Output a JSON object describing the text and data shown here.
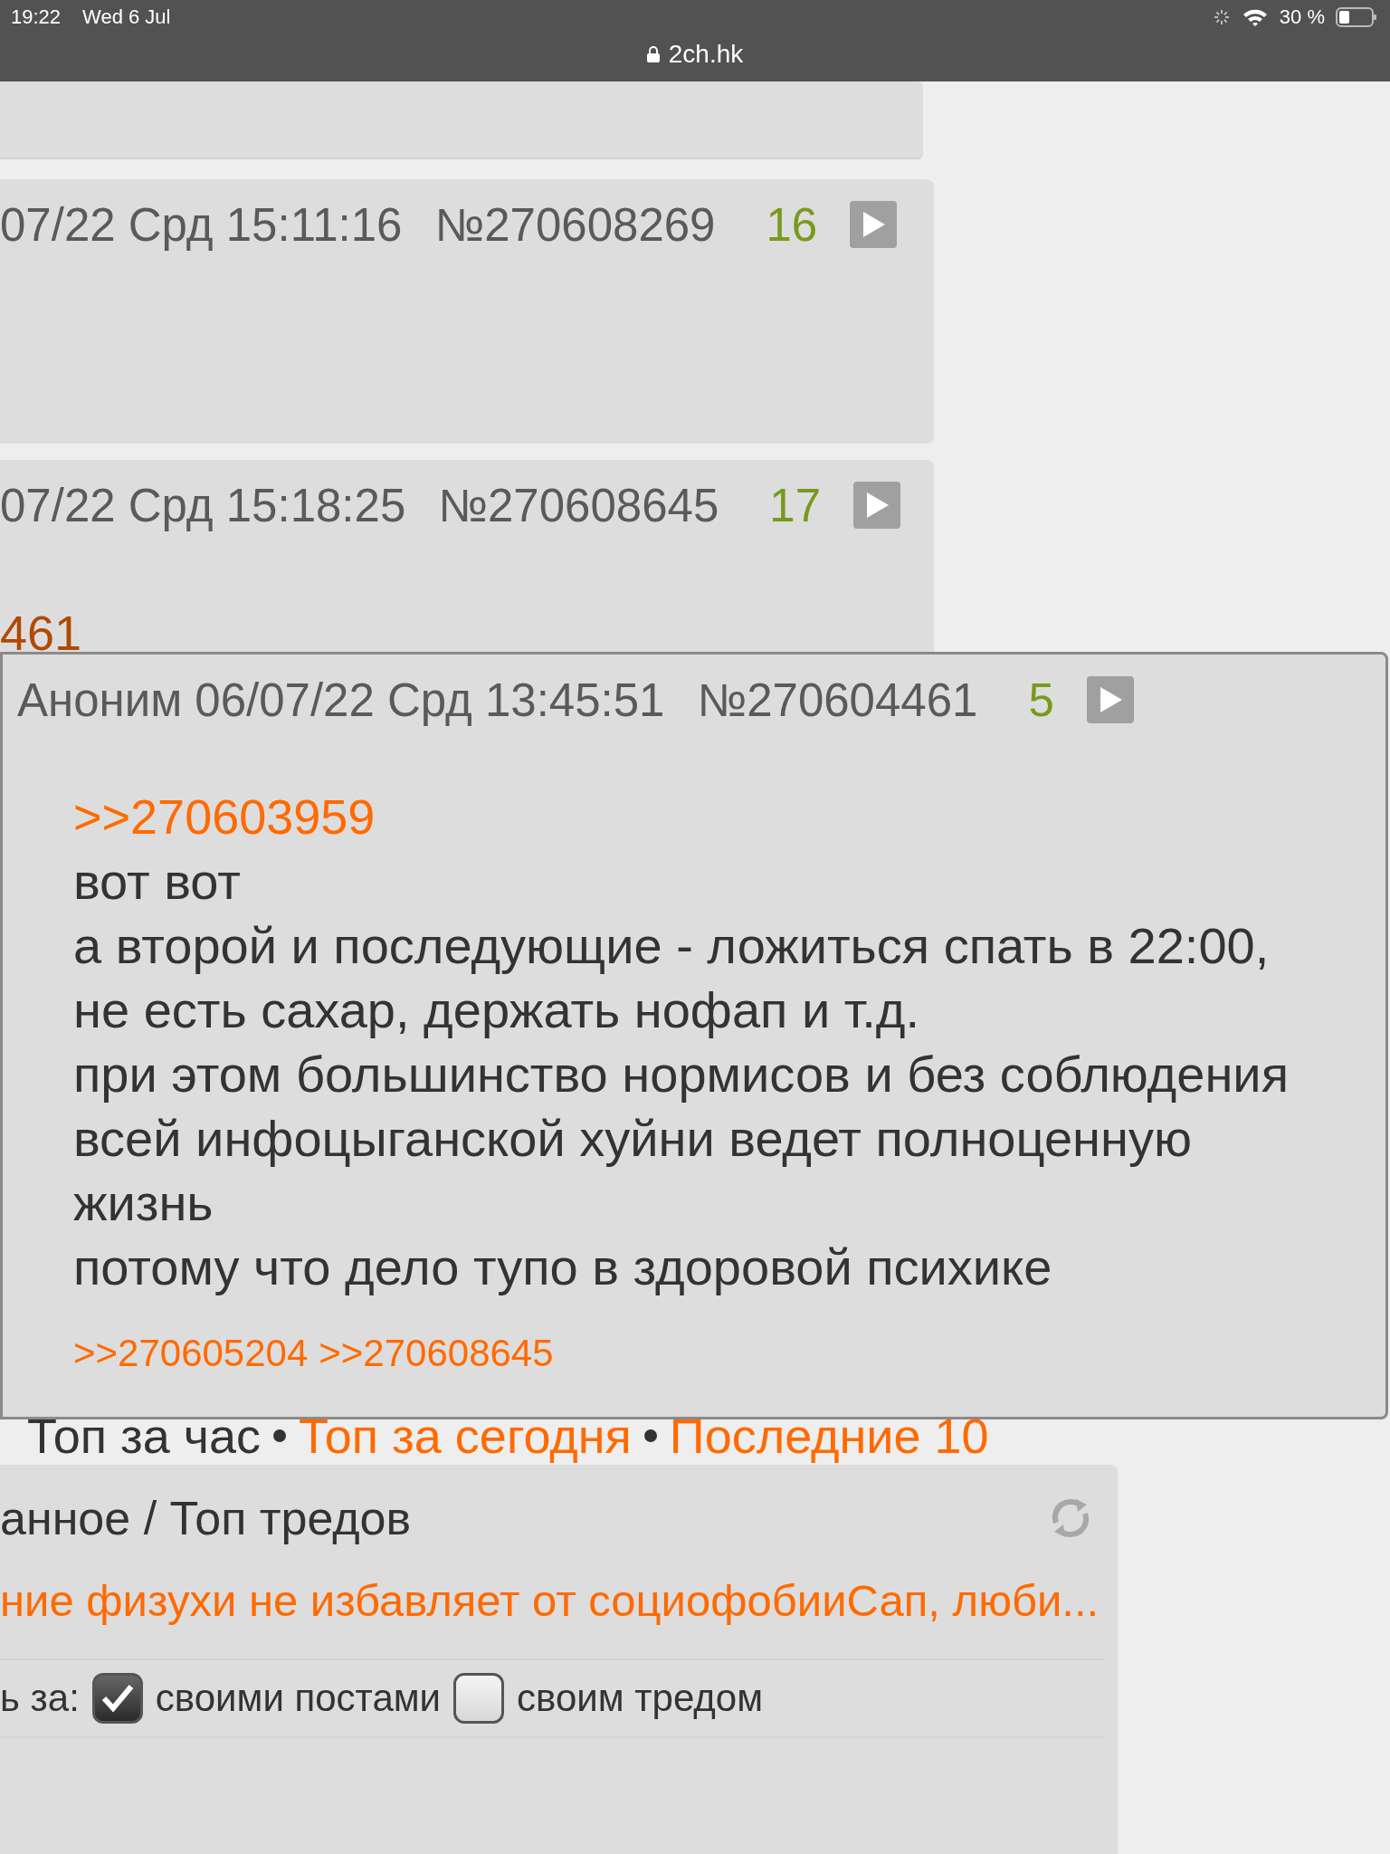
{
  "status_bar": {
    "time": "19:22",
    "date": "Wed 6 Jul",
    "battery": "30 %",
    "url": "2ch.hk"
  },
  "posts": [
    {
      "datetime": "07/22 Срд 15:11:16",
      "number": "№270608269",
      "index": "16"
    },
    {
      "datetime": "07/22 Срд 15:18:25",
      "number": "№270608645",
      "index": "17",
      "reply_link": "461"
    }
  ],
  "popup": {
    "author": "Аноним",
    "datetime": "06/07/22 Срд 13:45:51",
    "number": "№270604461",
    "index": "5",
    "reply_to": ">>270603959",
    "lines": [
      "вот вот",
      "а второй и последующие - ложиться спать в 22:00,",
      "не есть сахар, держать нофап и т.д.",
      "при этом большинство нормисов и без соблюдения",
      "всей инфоцыганской хуйни ведет полноценную",
      "жизнь",
      "потому что дело тупо в здоровой психике"
    ],
    "backlinks": [
      ">>270605204",
      ">>270608645"
    ]
  },
  "top_nav": [
    {
      "label": "Топ за час",
      "selected": true
    },
    {
      "label": "Топ за сегодня",
      "selected": false
    },
    {
      "label": "Последние 10",
      "selected": false
    }
  ],
  "panel": {
    "title": "анное / Топ тредов",
    "threads": [
      "ние физухи не избавляет от социофобииСап, люби..."
    ],
    "watch_label": "ь за:",
    "options": [
      {
        "label": "своими постами",
        "checked": true
      },
      {
        "label": "своим тредом",
        "checked": false
      }
    ]
  }
}
